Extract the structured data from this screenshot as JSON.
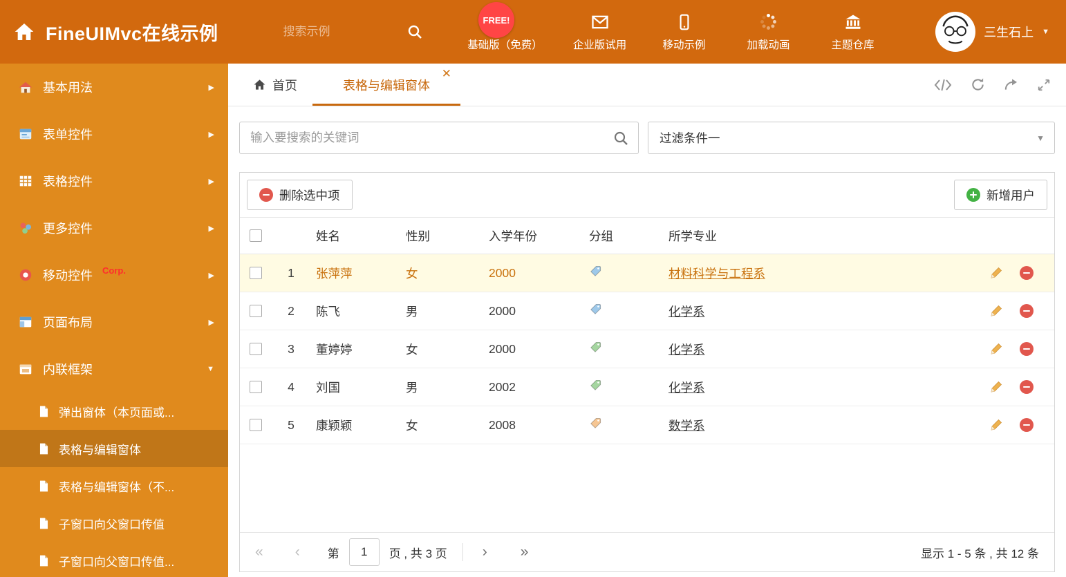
{
  "header": {
    "title": "FineUIMvc在线示例",
    "search_placeholder": "搜索示例",
    "free_badge": "FREE!",
    "nav_items": [
      {
        "icon": "download-icon",
        "label": "基础版（免费）"
      },
      {
        "icon": "envelope-icon",
        "label": "企业版试用"
      },
      {
        "icon": "phone-icon",
        "label": "移动示例"
      },
      {
        "icon": "spinner-icon",
        "label": "加载动画"
      },
      {
        "icon": "bank-icon",
        "label": "主题仓库"
      }
    ],
    "user_name": "三生石上"
  },
  "sidebar": {
    "items": [
      {
        "icon": "home-icon",
        "label": "基本用法",
        "chevron": "right"
      },
      {
        "icon": "form-icon",
        "label": "表单控件",
        "chevron": "right"
      },
      {
        "icon": "grid-icon",
        "label": "表格控件",
        "chevron": "right"
      },
      {
        "icon": "widgets-icon",
        "label": "更多控件",
        "chevron": "right"
      },
      {
        "icon": "mobile-red-icon",
        "label": "移动控件",
        "badge": "Corp.",
        "chevron": "right"
      },
      {
        "icon": "layout-icon",
        "label": "页面布局",
        "chevron": "right"
      },
      {
        "icon": "frame-icon",
        "label": "内联框架",
        "chevron": "down",
        "expanded": true
      }
    ],
    "subitems": [
      {
        "label": "弹出窗体（本页面或...",
        "active": false
      },
      {
        "label": "表格与编辑窗体",
        "active": true
      },
      {
        "label": "表格与编辑窗体（不...",
        "active": false
      },
      {
        "label": "子窗口向父窗口传值",
        "active": false
      },
      {
        "label": "子窗口向父窗口传值...",
        "active": false
      }
    ]
  },
  "tabs": {
    "home_label": "首页",
    "active_label": "表格与编辑窗体",
    "tools": [
      "code-icon",
      "refresh-icon",
      "share-icon",
      "expand-icon"
    ]
  },
  "filter_bar": {
    "search_placeholder": "输入要搜索的关键词",
    "filter_selected": "过滤条件一"
  },
  "toolbar": {
    "delete_label": "删除选中项",
    "add_label": "新增用户"
  },
  "table": {
    "columns": [
      "姓名",
      "性别",
      "入学年份",
      "分组",
      "所学专业"
    ],
    "rows": [
      {
        "index": "1",
        "name": "张萍萍",
        "gender": "女",
        "year": "2000",
        "tag": "blue",
        "major": "材料科学与工程系",
        "highlighted": true
      },
      {
        "index": "2",
        "name": "陈飞",
        "gender": "男",
        "year": "2000",
        "tag": "blue",
        "major": "化学系",
        "highlighted": false
      },
      {
        "index": "3",
        "name": "董婷婷",
        "gender": "女",
        "year": "2000",
        "tag": "green",
        "major": "化学系",
        "highlighted": false
      },
      {
        "index": "4",
        "name": "刘国",
        "gender": "男",
        "year": "2002",
        "tag": "green",
        "major": "化学系",
        "highlighted": false
      },
      {
        "index": "5",
        "name": "康颖颖",
        "gender": "女",
        "year": "2008",
        "tag": "orange",
        "major": "数学系",
        "highlighted": false
      }
    ]
  },
  "pagination": {
    "prefix": "第",
    "page_value": "1",
    "suffix": "页 , 共 3 页",
    "summary": "显示 1 - 5 条 , 共 12 条"
  },
  "colors": {
    "topbar": "#d2690e",
    "sidebar": "#e08a1d",
    "accent": "#c8690e",
    "free_badge": "#ff4545",
    "row_highlight": "#fffbe3",
    "tag_blue": "#9ec9ea",
    "tag_green": "#a5d6a0",
    "tag_orange": "#f6c693",
    "delete_red": "#e1574d",
    "add_green": "#43b244"
  }
}
